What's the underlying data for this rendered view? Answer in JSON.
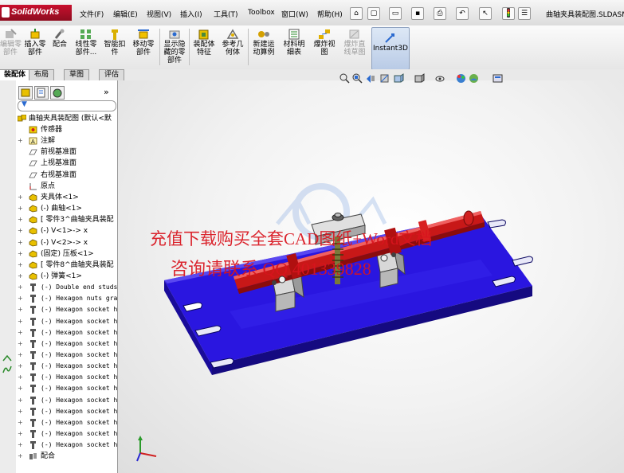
{
  "app": {
    "name": "SolidWorks",
    "doc_title": "曲轴夹具装配图.SLDASM"
  },
  "menu": {
    "items": [
      "文件(F)",
      "编辑(E)",
      "视图(V)",
      "插入(I)",
      "工具(T)",
      "Toolbox",
      "窗口(W)",
      "帮助(H)"
    ]
  },
  "commands": [
    {
      "label": "编辑零\n部件",
      "disabled": true
    },
    {
      "label": "插入零\n部件",
      "disabled": false
    },
    {
      "label": "配合",
      "disabled": false
    },
    {
      "label": "线性零\n部件...",
      "disabled": false
    },
    {
      "label": "智能扣\n件",
      "disabled": false
    },
    {
      "label": "移动零\n部件",
      "disabled": false
    },
    {
      "label": "显示隐\n藏的零\n部件",
      "disabled": false
    },
    {
      "label": "装配体\n特征",
      "disabled": false
    },
    {
      "label": "参考几\n何体",
      "disabled": false
    },
    {
      "label": "新建运\n动算例",
      "disabled": false
    },
    {
      "label": "材料明\n细表",
      "disabled": false
    },
    {
      "label": "爆炸视\n图",
      "disabled": false
    },
    {
      "label": "爆炸直\n线草图",
      "disabled": true
    },
    {
      "label": "Instant3D",
      "disabled": false
    }
  ],
  "tabs": [
    "装配体",
    "布局",
    "草图",
    "评估"
  ],
  "tree": {
    "root": "曲轴夹具装配图  (默认<默",
    "items": [
      {
        "text": "传感器",
        "icon": "sensor",
        "exp": "",
        "indent": 1
      },
      {
        "text": "注解",
        "icon": "annotation",
        "exp": "+",
        "indent": 1
      },
      {
        "text": "前视基准面",
        "icon": "plane",
        "exp": "",
        "indent": 1
      },
      {
        "text": "上视基准面",
        "icon": "plane",
        "exp": "",
        "indent": 1
      },
      {
        "text": "右视基准面",
        "icon": "plane",
        "exp": "",
        "indent": 1
      },
      {
        "text": "原点",
        "icon": "origin",
        "exp": "",
        "indent": 1
      },
      {
        "text": "夹具体<1>",
        "icon": "part",
        "exp": "+",
        "indent": 1
      },
      {
        "text": "(-) 曲轴<1>",
        "icon": "part",
        "exp": "+",
        "indent": 1
      },
      {
        "text": "[ 零件3^曲轴夹具装配",
        "icon": "part",
        "exp": "+",
        "indent": 1
      },
      {
        "text": "(-) V<1>-> x",
        "icon": "part",
        "exp": "+",
        "indent": 1
      },
      {
        "text": "(-) V<2>-> x",
        "icon": "part",
        "exp": "+",
        "indent": 1
      },
      {
        "text": "(固定) 压板<1>",
        "icon": "part",
        "exp": "+",
        "indent": 1
      },
      {
        "text": "[ 零件8^曲轴夹具装配",
        "icon": "part",
        "exp": "+",
        "indent": 1
      },
      {
        "text": "(-) 弹簧<1>",
        "icon": "part",
        "exp": "+",
        "indent": 1
      },
      {
        "text": "(-) Double end studs",
        "icon": "bolt",
        "exp": "+",
        "indent": 1,
        "mono": true
      },
      {
        "text": "(-) Hexagon nuts gra",
        "icon": "bolt",
        "exp": "+",
        "indent": 1,
        "mono": true
      },
      {
        "text": "(-) Hexagon socket h",
        "icon": "bolt",
        "exp": "+",
        "indent": 1,
        "mono": true
      },
      {
        "text": "(-) Hexagon socket h",
        "icon": "bolt",
        "exp": "+",
        "indent": 1,
        "mono": true
      },
      {
        "text": "(-) Hexagon socket h",
        "icon": "bolt",
        "exp": "+",
        "indent": 1,
        "mono": true
      },
      {
        "text": "(-) Hexagon socket h",
        "icon": "bolt",
        "exp": "+",
        "indent": 1,
        "mono": true
      },
      {
        "text": "(-) Hexagon socket h",
        "icon": "bolt",
        "exp": "+",
        "indent": 1,
        "mono": true
      },
      {
        "text": "(-) Hexagon socket h",
        "icon": "bolt",
        "exp": "+",
        "indent": 1,
        "mono": true
      },
      {
        "text": "(-) Hexagon socket h",
        "icon": "bolt",
        "exp": "+",
        "indent": 1,
        "mono": true
      },
      {
        "text": "(-) Hexagon socket h",
        "icon": "bolt",
        "exp": "+",
        "indent": 1,
        "mono": true
      },
      {
        "text": "(-) Hexagon socket h",
        "icon": "bolt",
        "exp": "+",
        "indent": 1,
        "mono": true
      },
      {
        "text": "(-) Hexagon socket h",
        "icon": "bolt",
        "exp": "+",
        "indent": 1,
        "mono": true
      },
      {
        "text": "(-) Hexagon socket h",
        "icon": "bolt",
        "exp": "+",
        "indent": 1,
        "mono": true
      },
      {
        "text": "(-) Hexagon socket h",
        "icon": "bolt",
        "exp": "+",
        "indent": 1,
        "mono": true
      },
      {
        "text": "(-) Hexagon socket h",
        "icon": "bolt",
        "exp": "+",
        "indent": 1,
        "mono": true
      },
      {
        "text": "配合",
        "icon": "mate",
        "exp": "+",
        "indent": 1
      }
    ]
  },
  "watermark": {
    "line1": "充值下载购买全套CAD图纸+Word文档",
    "line2": "咨询请联系 QQ 401339828"
  },
  "colors": {
    "base": "#2a16e0",
    "crankshaft": "#c81818",
    "fixture": "#d8d8d8",
    "brand": "#c8102e"
  }
}
